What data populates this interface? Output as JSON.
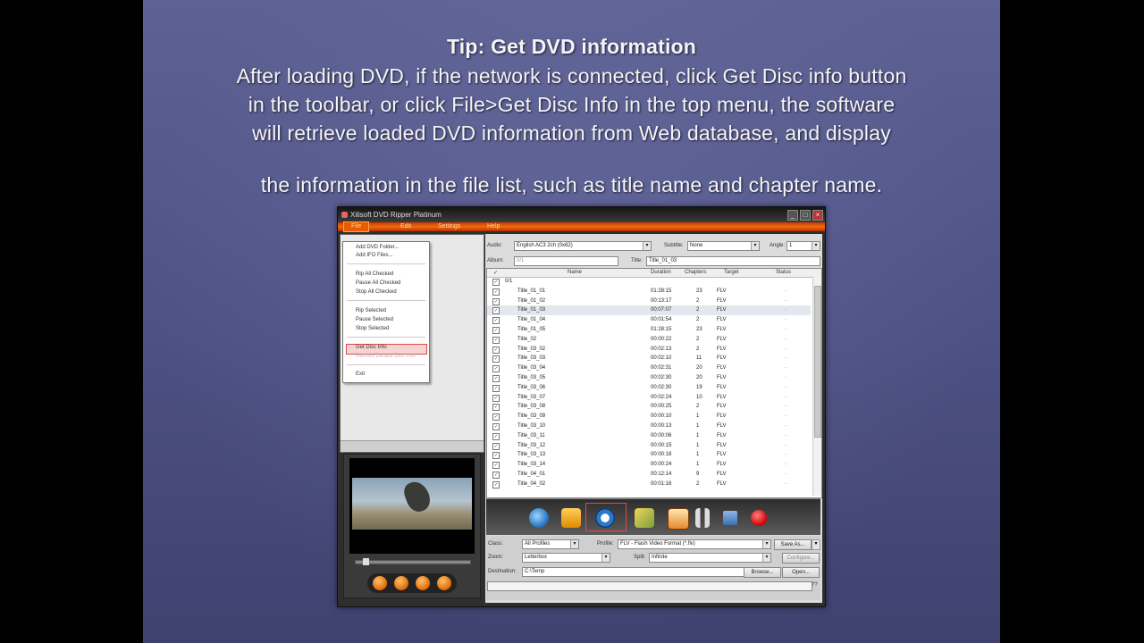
{
  "slide": {
    "title": "Tip: Get DVD information",
    "line1": "After loading DVD, if the network is connected, click Get Disc info button",
    "line2": "in the toolbar, or click File>Get Disc Info in the top menu, the software",
    "line3": "will retrieve loaded DVD information from Web database, and display",
    "line4": "the information in the file list, such as title name and chapter name."
  },
  "window": {
    "title": "Xilisoft DVD Ripper Platinum",
    "menu": [
      "File",
      "Edit",
      "Settings",
      "Help"
    ]
  },
  "file_menu": {
    "items": [
      "Add DVD Folder...",
      "Add IFO Files...",
      "Rip All Checked",
      "Pause All Checked",
      "Stop All Checked",
      "Rip Selected",
      "Pause Selected",
      "Stop Selected",
      "Get Disc Info",
      "Restore Default Disc Info",
      "Exit"
    ]
  },
  "top_fields": {
    "audio_label": "Audio:",
    "audio_value": "English AC3 2ch (0x82)",
    "subtitle_label": "Subtitle:",
    "subtitle_value": "None",
    "angle_label": "Angle:",
    "angle_value": "1",
    "album_label": "Album:",
    "album_value": "0/1",
    "title_label": "Title:",
    "title_value": "Title_01_03"
  },
  "list": {
    "columns": [
      "Name",
      "Duration",
      "Chapters",
      "Target",
      "Status"
    ],
    "root": "0/1",
    "rows": [
      {
        "name": "Title_01_01",
        "duration": "01:28:15",
        "chapters": "23",
        "target": "FLV",
        "status": "-"
      },
      {
        "name": "Title_01_02",
        "duration": "00:13:17",
        "chapters": "2",
        "target": "FLV",
        "status": "-"
      },
      {
        "name": "Title_01_03",
        "duration": "00:07:07",
        "chapters": "2",
        "target": "FLV",
        "status": "-"
      },
      {
        "name": "Title_01_04",
        "duration": "00:01:54",
        "chapters": "2",
        "target": "FLV",
        "status": "-"
      },
      {
        "name": "Title_01_05",
        "duration": "01:28:15",
        "chapters": "23",
        "target": "FLV",
        "status": "-"
      },
      {
        "name": "Title_02",
        "duration": "00:00:22",
        "chapters": "2",
        "target": "FLV",
        "status": "-"
      },
      {
        "name": "Title_03_02",
        "duration": "00:02:13",
        "chapters": "2",
        "target": "FLV",
        "status": "-"
      },
      {
        "name": "Title_03_03",
        "duration": "00:02:10",
        "chapters": "11",
        "target": "FLV",
        "status": "-"
      },
      {
        "name": "Title_03_04",
        "duration": "00:02:31",
        "chapters": "20",
        "target": "FLV",
        "status": "-"
      },
      {
        "name": "Title_03_05",
        "duration": "00:02:30",
        "chapters": "20",
        "target": "FLV",
        "status": "-"
      },
      {
        "name": "Title_03_06",
        "duration": "00:02:30",
        "chapters": "19",
        "target": "FLV",
        "status": "-"
      },
      {
        "name": "Title_03_07",
        "duration": "00:02:24",
        "chapters": "10",
        "target": "FLV",
        "status": "-"
      },
      {
        "name": "Title_03_08",
        "duration": "00:00:25",
        "chapters": "2",
        "target": "FLV",
        "status": "-"
      },
      {
        "name": "Title_03_09",
        "duration": "00:00:10",
        "chapters": "1",
        "target": "FLV",
        "status": "-"
      },
      {
        "name": "Title_03_10",
        "duration": "00:00:13",
        "chapters": "1",
        "target": "FLV",
        "status": "-"
      },
      {
        "name": "Title_03_11",
        "duration": "00:00:06",
        "chapters": "1",
        "target": "FLV",
        "status": "-"
      },
      {
        "name": "Title_03_12",
        "duration": "00:00:15",
        "chapters": "1",
        "target": "FLV",
        "status": "-"
      },
      {
        "name": "Title_03_13",
        "duration": "00:00:18",
        "chapters": "1",
        "target": "FLV",
        "status": "-"
      },
      {
        "name": "Title_03_14",
        "duration": "00:00:24",
        "chapters": "1",
        "target": "FLV",
        "status": "-"
      },
      {
        "name": "Title_04_01",
        "duration": "00:12:14",
        "chapters": "9",
        "target": "FLV",
        "status": "-"
      },
      {
        "name": "Title_04_02",
        "duration": "00:01:16",
        "chapters": "2",
        "target": "FLV",
        "status": "-"
      }
    ]
  },
  "bottom": {
    "class_label": "Class:",
    "class_value": "All Profiles",
    "profile_label": "Profile:",
    "profile_value": "FLV - Flash Video Format (*.flv)",
    "saveas": "Save As...",
    "zoom_label": "Zoom:",
    "zoom_value": "Letterbox",
    "split_label": "Split:",
    "split_value": "Infinite",
    "configure": "Configure...",
    "dest_label": "Destination:",
    "dest_value": "C:\\Temp",
    "browse": "Browse...",
    "open": "Open..."
  },
  "colors": {
    "menubar": "#f06b10",
    "highlight": "#e04848"
  }
}
